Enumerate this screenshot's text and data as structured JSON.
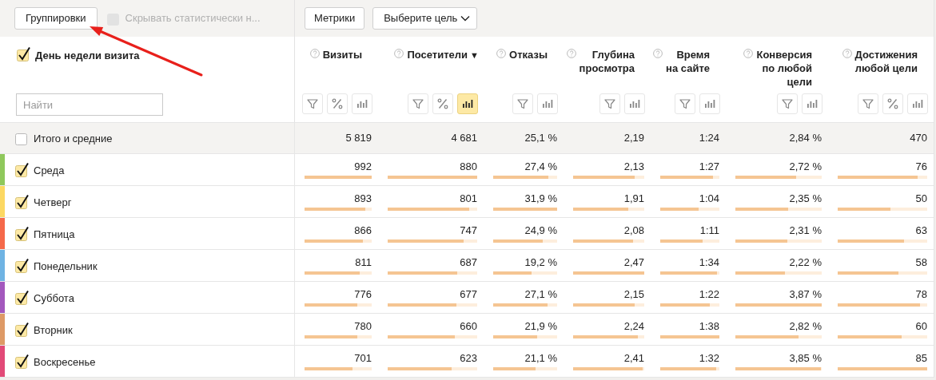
{
  "toolbar": {
    "groupings_button": "Группировки",
    "hide_insignificant": {
      "label": "Скрывать статистически н...",
      "checked": false,
      "disabled": true
    },
    "metrics_button": "Метрики",
    "goal_select": "Выберите цель"
  },
  "table": {
    "dimension": {
      "label": "День недели визита",
      "checked": true
    },
    "search": {
      "placeholder": "Найти"
    },
    "columns": [
      {
        "label": "Визиты",
        "tools": [
          {
            "kind": "filter",
            "selected": false
          },
          {
            "kind": "percent",
            "selected": false
          },
          {
            "kind": "chart",
            "selected": false
          }
        ]
      },
      {
        "label": "Посетители",
        "sort_mark": "▼",
        "tools": [
          {
            "kind": "filter",
            "selected": false
          },
          {
            "kind": "percent",
            "selected": false
          },
          {
            "kind": "chart",
            "selected": true
          }
        ]
      },
      {
        "label": "Отказы",
        "tools": [
          {
            "kind": "filter",
            "selected": false
          },
          {
            "kind": "chart",
            "selected": false
          }
        ]
      },
      {
        "label": "Глубина\nпросмотра",
        "tools": [
          {
            "kind": "filter",
            "selected": false
          },
          {
            "kind": "chart",
            "selected": false
          }
        ]
      },
      {
        "label": "Время\nна сайте",
        "tools": [
          {
            "kind": "filter",
            "selected": false
          },
          {
            "kind": "chart",
            "selected": false
          }
        ]
      },
      {
        "label": "Конверсия\nпо любой\nцели",
        "tools": [
          {
            "kind": "filter",
            "selected": false
          },
          {
            "kind": "chart",
            "selected": false
          }
        ]
      },
      {
        "label": "Достижения\nлюбой цели",
        "tools": [
          {
            "kind": "filter",
            "selected": false
          },
          {
            "kind": "percent",
            "selected": false
          },
          {
            "kind": "chart",
            "selected": false
          }
        ]
      }
    ],
    "totals": {
      "label": "Итого и средние",
      "checked": false,
      "values": [
        "5 819",
        "4 681",
        "25,1 %",
        "2,19",
        "1:24",
        "2,84 %",
        "470"
      ]
    },
    "rows": [
      {
        "label": "Среда",
        "checked": true,
        "color": "#8fc85c",
        "cells": [
          {
            "value": "992",
            "level": 1.0
          },
          {
            "value": "880",
            "level": 1.0
          },
          {
            "value": "27,4 %",
            "level": 0.86
          },
          {
            "value": "2,13",
            "level": 0.86
          },
          {
            "value": "1:27",
            "level": 0.89
          },
          {
            "value": "2,72 %",
            "level": 0.7
          },
          {
            "value": "76",
            "level": 0.89
          }
        ]
      },
      {
        "label": "Четверг",
        "checked": true,
        "color": "#fcd862",
        "cells": [
          {
            "value": "893",
            "level": 0.9
          },
          {
            "value": "801",
            "level": 0.91
          },
          {
            "value": "31,9 %",
            "level": 1.0
          },
          {
            "value": "1,91",
            "level": 0.77
          },
          {
            "value": "1:04",
            "level": 0.65
          },
          {
            "value": "2,35 %",
            "level": 0.61
          },
          {
            "value": "50",
            "level": 0.59
          }
        ]
      },
      {
        "label": "Пятница",
        "checked": true,
        "color": "#f5694a",
        "cells": [
          {
            "value": "866",
            "level": 0.87
          },
          {
            "value": "747",
            "level": 0.85
          },
          {
            "value": "24,9 %",
            "level": 0.78
          },
          {
            "value": "2,08",
            "level": 0.84
          },
          {
            "value": "1:11",
            "level": 0.72
          },
          {
            "value": "2,31 %",
            "level": 0.6
          },
          {
            "value": "63",
            "level": 0.74
          }
        ]
      },
      {
        "label": "Понедельник",
        "checked": true,
        "color": "#6fb3e3",
        "cells": [
          {
            "value": "811",
            "level": 0.82
          },
          {
            "value": "687",
            "level": 0.78
          },
          {
            "value": "19,2 %",
            "level": 0.6
          },
          {
            "value": "2,47",
            "level": 1.0
          },
          {
            "value": "1:34",
            "level": 0.96
          },
          {
            "value": "2,22 %",
            "level": 0.57
          },
          {
            "value": "58",
            "level": 0.68
          }
        ]
      },
      {
        "label": "Суббота",
        "checked": true,
        "color": "#a358bd",
        "cells": [
          {
            "value": "776",
            "level": 0.78
          },
          {
            "value": "677",
            "level": 0.77
          },
          {
            "value": "27,1 %",
            "level": 0.85
          },
          {
            "value": "2,15",
            "level": 0.87
          },
          {
            "value": "1:22",
            "level": 0.84
          },
          {
            "value": "3,87 %",
            "level": 1.0
          },
          {
            "value": "78",
            "level": 0.92
          }
        ]
      },
      {
        "label": "Вторник",
        "checked": true,
        "color": "#de9a66",
        "cells": [
          {
            "value": "780",
            "level": 0.79
          },
          {
            "value": "660",
            "level": 0.75
          },
          {
            "value": "21,9 %",
            "level": 0.69
          },
          {
            "value": "2,24",
            "level": 0.91
          },
          {
            "value": "1:38",
            "level": 1.0
          },
          {
            "value": "2,82 %",
            "level": 0.73
          },
          {
            "value": "60",
            "level": 0.71
          }
        ]
      },
      {
        "label": "Воскресенье",
        "checked": true,
        "color": "#e24a78",
        "cells": [
          {
            "value": "701",
            "level": 0.71
          },
          {
            "value": "623",
            "level": 0.71
          },
          {
            "value": "21,1 %",
            "level": 0.66
          },
          {
            "value": "2,41",
            "level": 0.98
          },
          {
            "value": "1:32",
            "level": 0.94
          },
          {
            "value": "3,85 %",
            "level": 0.99
          },
          {
            "value": "85",
            "level": 1.0
          }
        ]
      }
    ]
  }
}
